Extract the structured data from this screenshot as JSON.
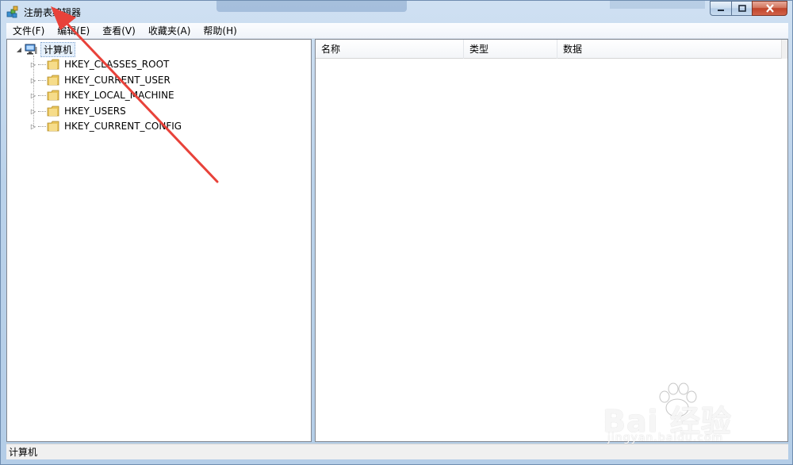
{
  "window": {
    "title": "注册表编辑器",
    "controls": {
      "minimize": "minimize-icon",
      "maximize": "maximize-icon",
      "close": "close-icon"
    }
  },
  "menu": [
    {
      "label": "文件(F)"
    },
    {
      "label": "编辑(E)"
    },
    {
      "label": "查看(V)"
    },
    {
      "label": "收藏夹(A)"
    },
    {
      "label": "帮助(H)"
    }
  ],
  "tree": {
    "root": {
      "label": "计算机",
      "icon": "computer-icon",
      "expanded": true
    },
    "keys": [
      {
        "label": "HKEY_CLASSES_ROOT",
        "icon": "folder-icon"
      },
      {
        "label": "HKEY_CURRENT_USER",
        "icon": "folder-icon"
      },
      {
        "label": "HKEY_LOCAL_MACHINE",
        "icon": "folder-icon"
      },
      {
        "label": "HKEY_USERS",
        "icon": "folder-icon"
      },
      {
        "label": "HKEY_CURRENT_CONFIG",
        "icon": "folder-icon"
      }
    ]
  },
  "list": {
    "columns": [
      {
        "label": "名称"
      },
      {
        "label": "类型"
      },
      {
        "label": "数据"
      }
    ]
  },
  "status": {
    "path": "计算机"
  },
  "watermark": {
    "brand": "Bai 经验",
    "url": "jingyan.baidu.com"
  },
  "colors": {
    "annotation_arrow": "#e8423a",
    "selection_bg": "#e5f0fb"
  }
}
